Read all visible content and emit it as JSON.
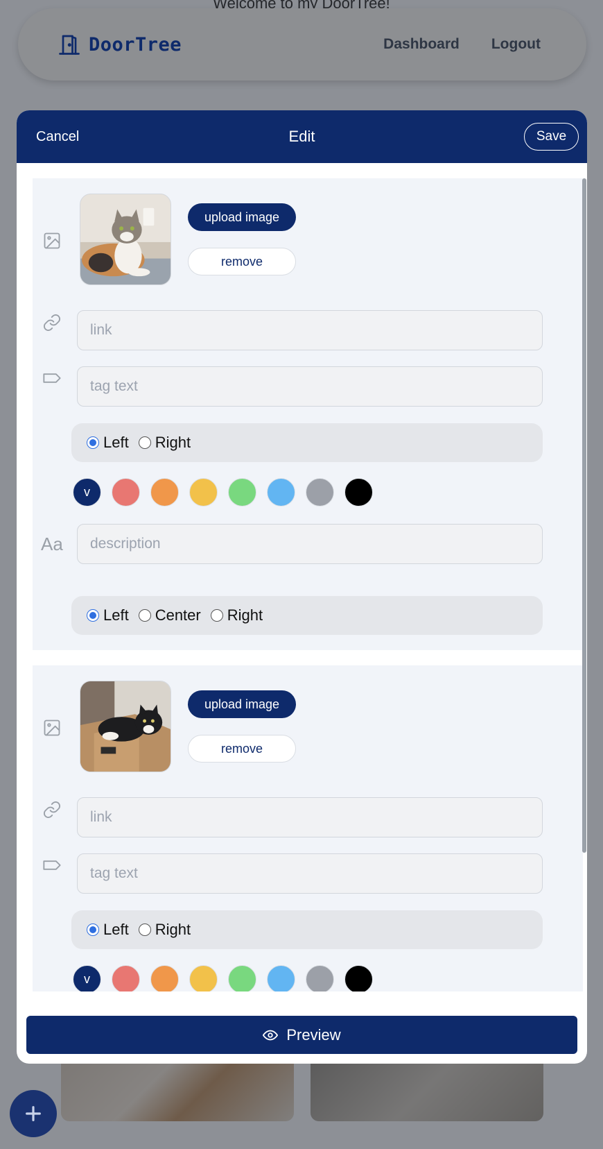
{
  "background": {
    "welcome_text": "Welcome to my DoorTree!"
  },
  "navbar": {
    "brand": "DoorTree",
    "links": [
      "Dashboard",
      "Logout"
    ]
  },
  "modal": {
    "cancel_label": "Cancel",
    "title": "Edit",
    "save_label": "Save",
    "preview_label": "Preview"
  },
  "cards": [
    {
      "upload_label": "upload image",
      "remove_label": "remove",
      "link_placeholder": "link",
      "tag_placeholder": "tag text",
      "tag_position": {
        "options": [
          "Left",
          "Right"
        ],
        "selected": "Left"
      },
      "description_placeholder": "description",
      "description_align": {
        "options": [
          "Left",
          "Center",
          "Right"
        ],
        "selected": "Left"
      },
      "selected_color_label": "v"
    },
    {
      "upload_label": "upload image",
      "remove_label": "remove",
      "link_placeholder": "link",
      "tag_placeholder": "tag text",
      "tag_position": {
        "options": [
          "Left",
          "Right"
        ],
        "selected": "Left"
      },
      "selected_color_label": "v"
    }
  ],
  "colors": {
    "primary": "#0e2a6b",
    "swatches": [
      "#0e2a6b",
      "#e87772",
      "#f0974a",
      "#f2c14a",
      "#79d87f",
      "#62b5f2",
      "#9ca0a8",
      "#000000"
    ]
  },
  "icons": {
    "image_row": "image-icon",
    "link_row": "link-icon",
    "tag_row": "tag-icon",
    "description_row": "text-font-icon",
    "preview": "eye-icon",
    "fab": "plus-icon"
  }
}
